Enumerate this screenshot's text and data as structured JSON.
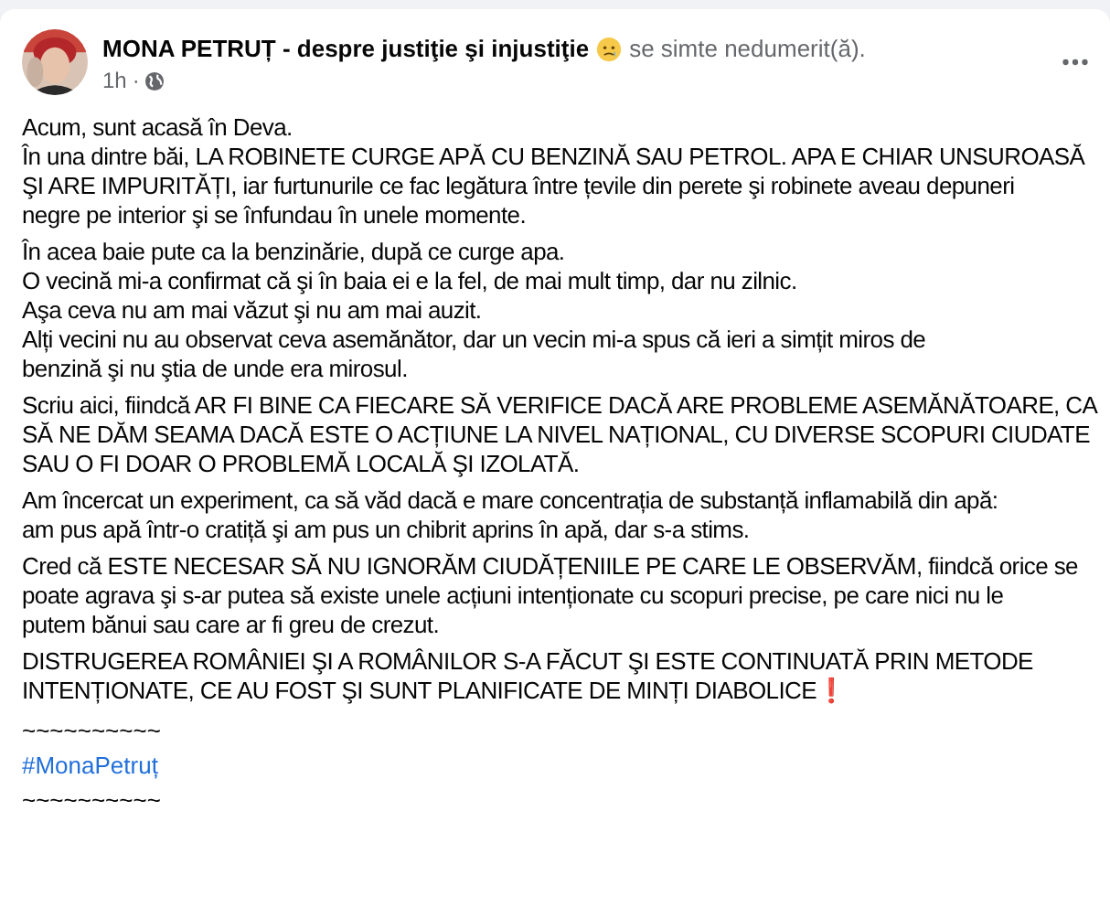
{
  "post": {
    "author": "MONA PETRUȚ - despre justiţie şi injustiţie",
    "feeling": "se simte nedumerit(ă).",
    "time": "1h",
    "separator": "·",
    "body": [
      {
        "kind": "paragraph",
        "lines": [
          "Acum, sunt acasă în Deva.",
          "În una dintre băi, LA ROBINETE CURGE APĂ CU BENZINĂ SAU PETROL. APA E CHIAR UNSUROASĂ",
          "ŞI ARE IMPURITĂȚI, iar furtunurile ce fac legătura între țevile din perete şi robinete aveau depuneri",
          "negre pe interior şi se înfundau în unele momente."
        ]
      },
      {
        "kind": "paragraph",
        "lines": [
          "În acea baie pute ca la benzinărie, după ce curge apa.",
          "O vecină mi-a confirmat că şi în baia ei e la fel, de mai mult timp, dar nu zilnic.",
          "Aşa ceva nu am mai văzut şi nu am mai auzit.",
          "Alți vecini nu au observat ceva asemănător, dar un vecin mi-a spus că ieri a simțit miros de",
          "benzină şi nu ştia de unde era mirosul."
        ]
      },
      {
        "kind": "paragraph",
        "lines": [
          "Scriu aici, fiindcă AR FI BINE CA FIECARE SĂ VERIFICE DACĂ ARE PROBLEME ASEMĂNĂTOARE, CA",
          "SĂ NE DĂM SEAMA DACĂ ESTE O ACȚIUNE LA NIVEL NAȚIONAL, CU DIVERSE SCOPURI CIUDATE",
          "SAU O FI DOAR O PROBLEMĂ LOCALĂ ŞI IZOLATĂ."
        ]
      },
      {
        "kind": "paragraph",
        "lines": [
          "Am încercat un experiment, ca să văd dacă e mare concentrația de substanță inflamabilă din apă:",
          "am pus apă într-o cratiță şi am pus un chibrit aprins în apă, dar s-a stims."
        ]
      },
      {
        "kind": "paragraph",
        "lines": [
          "Cred că ESTE NECESAR SĂ NU IGNORĂM CIUDĂȚENIILE PE CARE LE OBSERVĂM, fiindcă orice se",
          "poate agrava şi s-ar putea să existe unele acțiuni intenționate cu scopuri precise, pe care nici nu le",
          "putem bănui sau care ar fi greu de crezut."
        ]
      },
      {
        "kind": "paragraph",
        "lines": [
          "DISTRUGEREA ROMÂNIEI ŞI A ROMÂNILOR S-A FĂCUT ŞI ESTE CONTINUATĂ PRIN METODE",
          "INTENȚIONATE, CE AU FOST ŞI SUNT PLANIFICATE DE MINȚI DIABOLICE❗"
        ]
      },
      {
        "kind": "divider",
        "text": "~~~~~~~~~~"
      },
      {
        "kind": "hashtag",
        "text": "#MonaPetruț"
      },
      {
        "kind": "divider",
        "text": "~~~~~~~~~~"
      }
    ]
  }
}
